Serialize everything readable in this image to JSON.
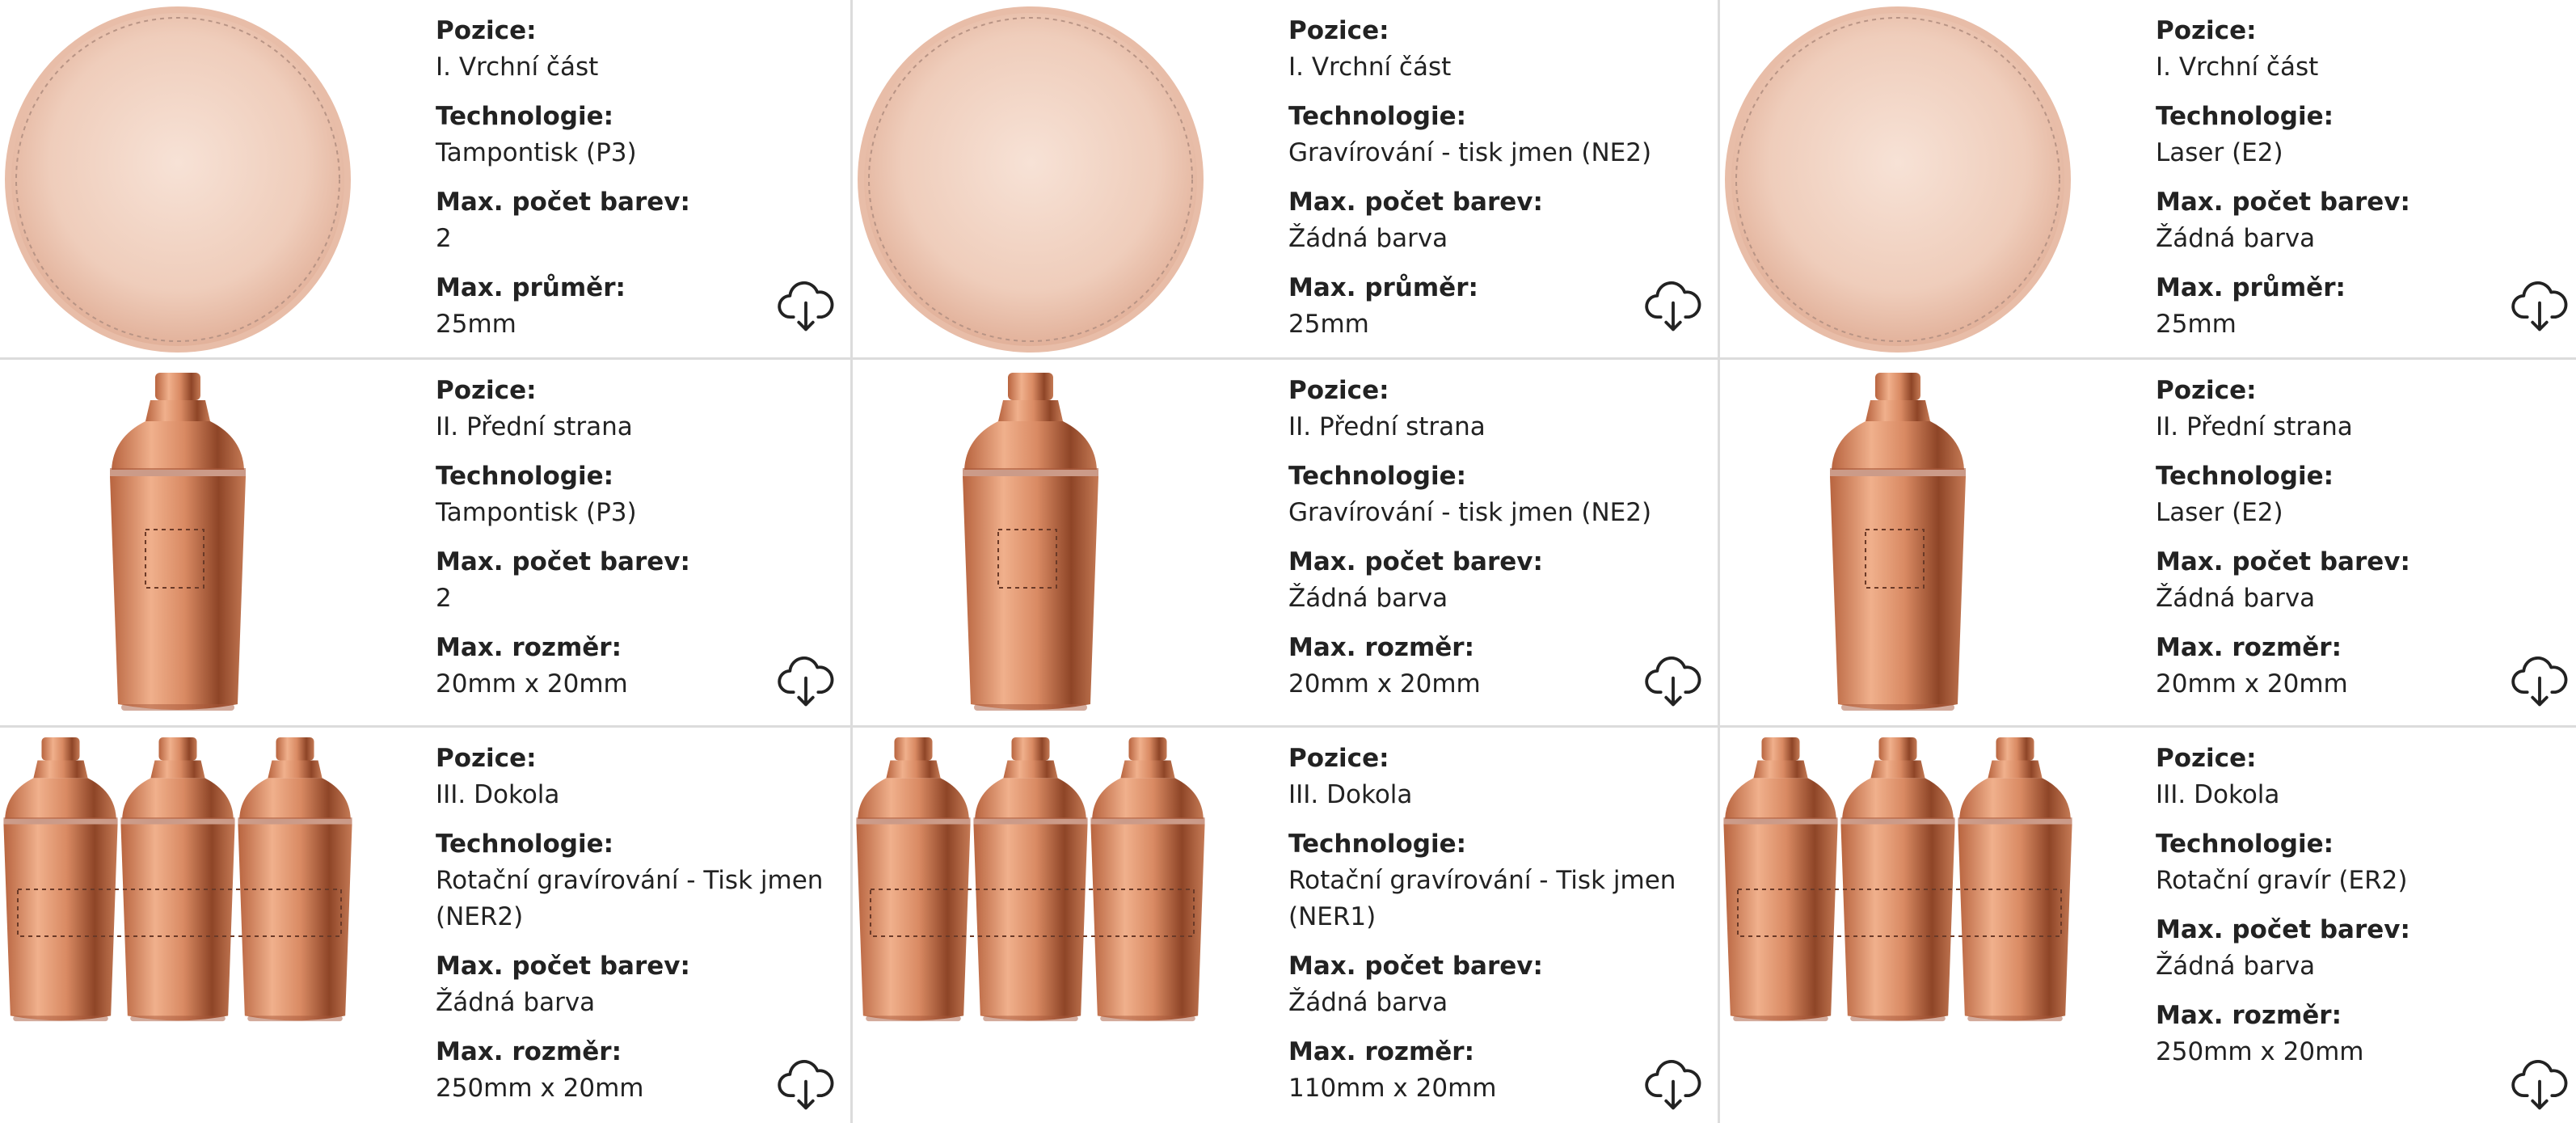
{
  "labels": {
    "position": "Pozice:",
    "technology": "Technologie:",
    "max_colors": "Max. počet barev:",
    "max_diameter": "Max. průměr:",
    "max_size": "Max. rozměr:"
  },
  "colors": {
    "copper": "#d98a63",
    "copper_dark": "#a8583a",
    "lid": "#efcdbb",
    "divider": "#dcdcdc"
  },
  "cells": [
    {
      "image": "lid-top-view",
      "position": "I. Vrchní část",
      "technology": "Tampontisk (P3)",
      "max_colors": "2",
      "size_label_key": "max_diameter",
      "size": "25mm"
    },
    {
      "image": "lid-top-view",
      "position": "I. Vrchní část",
      "technology": "Gravírování - tisk jmen (NE2)",
      "max_colors": "Žádná barva",
      "size_label_key": "max_diameter",
      "size": "25mm"
    },
    {
      "image": "lid-top-view",
      "position": "I. Vrchní část",
      "technology": "Laser (E2)",
      "max_colors": "Žádná barva",
      "size_label_key": "max_diameter",
      "size": "25mm"
    },
    {
      "image": "shaker-front",
      "position": "II. Přední strana",
      "technology": "Tampontisk (P3)",
      "max_colors": "2",
      "size_label_key": "max_size",
      "size": "20mm x 20mm"
    },
    {
      "image": "shaker-front",
      "position": "II. Přední strana",
      "technology": "Gravírování - tisk jmen (NE2)",
      "max_colors": "Žádná barva",
      "size_label_key": "max_size",
      "size": "20mm x 20mm"
    },
    {
      "image": "shaker-front",
      "position": "II. Přední strana",
      "technology": "Laser (E2)",
      "max_colors": "Žádná barva",
      "size_label_key": "max_size",
      "size": "20mm x 20mm"
    },
    {
      "image": "shaker-around",
      "position": "III. Dokola",
      "technology": "Rotační gravírování - Tisk jmen (NER2)",
      "max_colors": "Žádná barva",
      "size_label_key": "max_size",
      "size": "250mm x 20mm"
    },
    {
      "image": "shaker-around",
      "position": "III. Dokola",
      "technology": "Rotační gravírování - Tisk jmen (NER1)",
      "max_colors": "Žádná barva",
      "size_label_key": "max_size",
      "size": "110mm x 20mm"
    },
    {
      "image": "shaker-around",
      "position": "III. Dokola",
      "technology": "Rotační gravír (ER2)",
      "max_colors": "Žádná barva",
      "size_label_key": "max_size",
      "size": "250mm x 20mm"
    }
  ]
}
